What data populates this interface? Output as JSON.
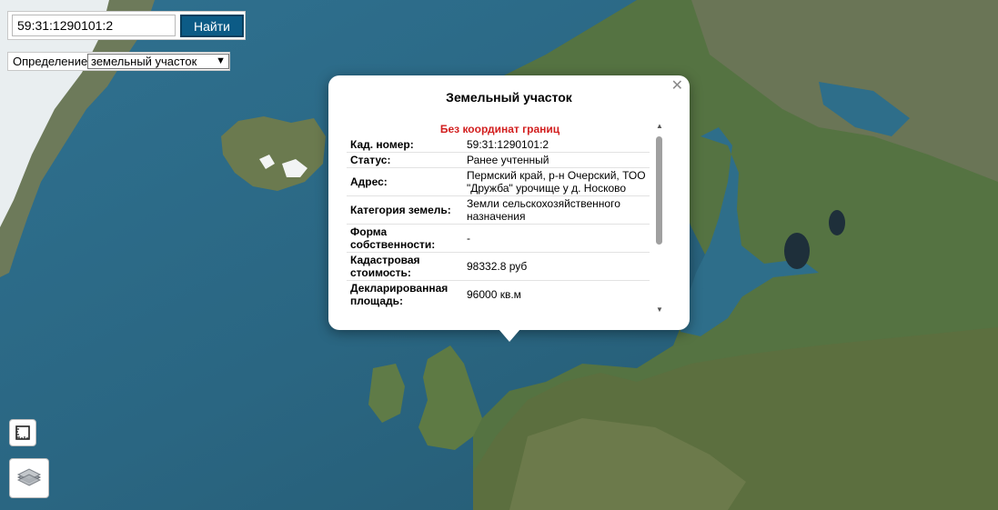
{
  "search": {
    "query": "59:31:1290101:2",
    "button_label": "Найти"
  },
  "definition": {
    "label": "Определение:",
    "selected": "земельный участок"
  },
  "popup": {
    "title": "Земельный участок",
    "warning": "Без координат границ",
    "close_icon": "close-icon",
    "rows": [
      {
        "key": "Кад. номер:",
        "value": "59:31:1290101:2"
      },
      {
        "key": "Статус:",
        "value": "Ранее учтенный"
      },
      {
        "key": "Адрес:",
        "value": "Пермский край, р-н Очерский, ТОО \"Дружба\" урочище у д. Носково"
      },
      {
        "key": "Категория земель:",
        "value": "Земли сельскохозяйственного назначения"
      },
      {
        "key": "Форма собственности:",
        "value": "-"
      },
      {
        "key": "Кадастровая стоимость:",
        "value": "98332.8 руб"
      },
      {
        "key": "Декларированная площадь:",
        "value": "96000 кв.м"
      }
    ]
  },
  "controls": {
    "ruler_icon": "ruler-icon",
    "layers_icon": "layers-icon"
  },
  "colors": {
    "sea": "#2b6a85",
    "land": "#5d7a45",
    "button": "#0c5b86",
    "warning": "#d21f1f"
  }
}
